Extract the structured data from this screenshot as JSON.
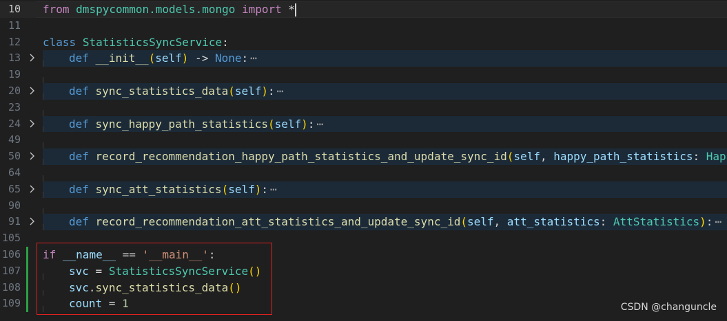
{
  "editor": {
    "lines": [
      {
        "ln": "10",
        "current": true,
        "tokens": [
          {
            "t": "from",
            "c": "ctrl"
          },
          {
            "t": " ",
            "c": "plain"
          },
          {
            "t": "dmspycommon.models.mongo",
            "c": "cls"
          },
          {
            "t": " ",
            "c": "plain"
          },
          {
            "t": "import",
            "c": "ctrl"
          },
          {
            "t": " *",
            "c": "plain"
          }
        ],
        "cursor": true
      },
      {
        "ln": "11",
        "tokens": []
      },
      {
        "ln": "12",
        "tokens": [
          {
            "t": "class",
            "c": "kw"
          },
          {
            "t": " ",
            "c": "plain"
          },
          {
            "t": "StatisticsSyncService",
            "c": "cls"
          },
          {
            "t": ":",
            "c": "plain"
          }
        ]
      },
      {
        "ln": "13",
        "folded": true,
        "indent": 1,
        "tokens": [
          {
            "t": "def",
            "c": "kw"
          },
          {
            "t": " ",
            "c": "plain"
          },
          {
            "t": "__init__",
            "c": "fn"
          },
          {
            "t": "(",
            "c": "p1"
          },
          {
            "t": "self",
            "c": "var"
          },
          {
            "t": ")",
            "c": "p1"
          },
          {
            "t": " -> ",
            "c": "plain"
          },
          {
            "t": "None",
            "c": "kw"
          },
          {
            "t": ":",
            "c": "plain"
          }
        ]
      },
      {
        "ln": "19",
        "indent": 1,
        "tokens": []
      },
      {
        "ln": "20",
        "folded": true,
        "indent": 1,
        "tokens": [
          {
            "t": "def",
            "c": "kw"
          },
          {
            "t": " ",
            "c": "plain"
          },
          {
            "t": "sync_statistics_data",
            "c": "fn"
          },
          {
            "t": "(",
            "c": "p1"
          },
          {
            "t": "self",
            "c": "var"
          },
          {
            "t": ")",
            "c": "p1"
          },
          {
            "t": ":",
            "c": "plain"
          }
        ]
      },
      {
        "ln": "23",
        "indent": 1,
        "tokens": []
      },
      {
        "ln": "24",
        "folded": true,
        "indent": 1,
        "tokens": [
          {
            "t": "def",
            "c": "kw"
          },
          {
            "t": " ",
            "c": "plain"
          },
          {
            "t": "sync_happy_path_statistics",
            "c": "fn"
          },
          {
            "t": "(",
            "c": "p1"
          },
          {
            "t": "self",
            "c": "var"
          },
          {
            "t": ")",
            "c": "p1"
          },
          {
            "t": ":",
            "c": "plain"
          }
        ]
      },
      {
        "ln": "49",
        "indent": 1,
        "tokens": []
      },
      {
        "ln": "50",
        "folded": true,
        "indent": 1,
        "noellipsis": true,
        "tokens": [
          {
            "t": "def",
            "c": "kw"
          },
          {
            "t": " ",
            "c": "plain"
          },
          {
            "t": "record_recommendation_happy_path_statistics_and_update_sync_id",
            "c": "fn"
          },
          {
            "t": "(",
            "c": "p1"
          },
          {
            "t": "self",
            "c": "var"
          },
          {
            "t": ", ",
            "c": "plain"
          },
          {
            "t": "happy_path_statistics",
            "c": "var"
          },
          {
            "t": ": ",
            "c": "plain"
          },
          {
            "t": "Happ",
            "c": "cls"
          }
        ]
      },
      {
        "ln": "64",
        "indent": 1,
        "tokens": []
      },
      {
        "ln": "65",
        "folded": true,
        "indent": 1,
        "tokens": [
          {
            "t": "def",
            "c": "kw"
          },
          {
            "t": " ",
            "c": "plain"
          },
          {
            "t": "sync_att_statistics",
            "c": "fn"
          },
          {
            "t": "(",
            "c": "p1"
          },
          {
            "t": "self",
            "c": "var"
          },
          {
            "t": ")",
            "c": "p1"
          },
          {
            "t": ":",
            "c": "plain"
          }
        ]
      },
      {
        "ln": "90",
        "indent": 1,
        "tokens": []
      },
      {
        "ln": "91",
        "folded": true,
        "indent": 1,
        "tokens": [
          {
            "t": "def",
            "c": "kw"
          },
          {
            "t": " ",
            "c": "plain"
          },
          {
            "t": "record_recommendation_att_statistics_and_update_sync_id",
            "c": "fn"
          },
          {
            "t": "(",
            "c": "p1"
          },
          {
            "t": "self",
            "c": "var"
          },
          {
            "t": ", ",
            "c": "plain"
          },
          {
            "t": "att_statistics",
            "c": "var"
          },
          {
            "t": ": ",
            "c": "plain"
          },
          {
            "t": "AttStatistics",
            "c": "cls"
          },
          {
            "t": ")",
            "c": "p1"
          },
          {
            "t": ":",
            "c": "plain"
          }
        ]
      },
      {
        "ln": "105",
        "tokens": []
      },
      {
        "ln": "106",
        "changed": true,
        "tokens": [
          {
            "t": "if",
            "c": "ctrl"
          },
          {
            "t": " ",
            "c": "plain"
          },
          {
            "t": "__name__",
            "c": "var"
          },
          {
            "t": " == ",
            "c": "plain"
          },
          {
            "t": "'__main__'",
            "c": "str"
          },
          {
            "t": ":",
            "c": "plain"
          }
        ]
      },
      {
        "ln": "107",
        "changed": true,
        "indent": 1,
        "tokens": [
          {
            "t": "svc",
            "c": "var"
          },
          {
            "t": " = ",
            "c": "plain"
          },
          {
            "t": "StatisticsSyncService",
            "c": "cls"
          },
          {
            "t": "()",
            "c": "p1"
          }
        ]
      },
      {
        "ln": "108",
        "changed": true,
        "indent": 1,
        "tokens": [
          {
            "t": "svc",
            "c": "var"
          },
          {
            "t": ".",
            "c": "plain"
          },
          {
            "t": "sync_statistics_data",
            "c": "fn"
          },
          {
            "t": "()",
            "c": "p1"
          }
        ]
      },
      {
        "ln": "109",
        "changed": true,
        "indent": 1,
        "tokens": [
          {
            "t": "count",
            "c": "var"
          },
          {
            "t": " = ",
            "c": "plain"
          },
          {
            "t": "1",
            "c": "num"
          }
        ]
      }
    ],
    "fold_icon": "chevron-right-icon",
    "ellipsis": "⋯"
  },
  "watermark": "CSDN @changuncle"
}
